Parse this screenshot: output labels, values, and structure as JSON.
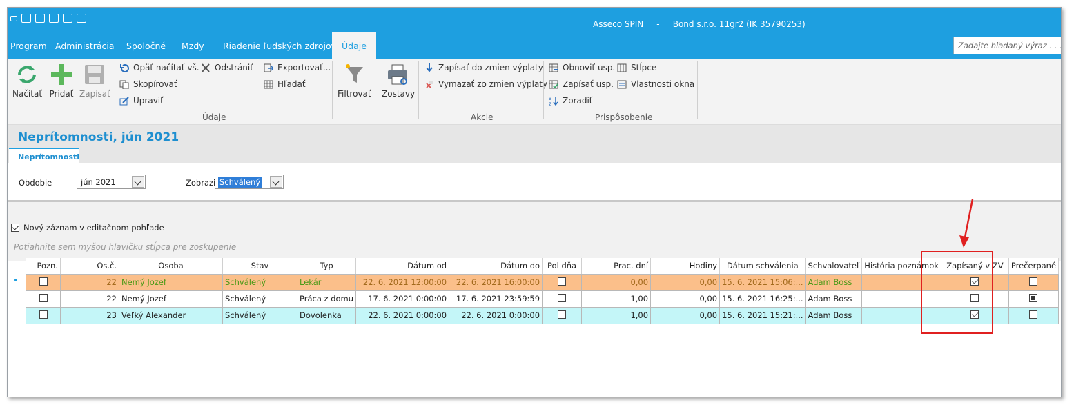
{
  "app": {
    "title": "Asseco SPIN",
    "separator": "-",
    "company": "Bond s.r.o. 11gr2 (IK 35790253)"
  },
  "menu": {
    "items": [
      "Program",
      "Administrácia",
      "Spoločné",
      "Mzdy",
      "Riadenie ľudských zdrojov",
      "Údaje"
    ],
    "active": "Údaje"
  },
  "search": {
    "placeholder": "Zadajte hľadaný výraz . . ."
  },
  "ribbon": {
    "big_buttons": {
      "load": "Načítať",
      "add": "Pridať",
      "save": "Zapísať",
      "filter": "Filtrovať",
      "reports": "Zostavy"
    },
    "data_group": {
      "reload": "Opäť načítať vš.",
      "remove": "Odstrániť",
      "copy": "Skopírovať",
      "edit": "Upraviť",
      "export": "Exportovať...",
      "find": "Hľadať",
      "label": "Údaje"
    },
    "actions_group": {
      "write": "Zapísať do zmien výplaty",
      "erase": "Vymazať zo zmien výplaty",
      "label": "Akcie"
    },
    "custom_group": {
      "refresh": "Obnoviť usp.",
      "columns": "Stĺpce",
      "write": "Zapísať usp.",
      "props": "Vlastnosti okna",
      "sort": "Zoradiť",
      "label": "Prispôsobenie"
    }
  },
  "page": {
    "title": "Neprítomnosti, jún 2021",
    "tab": "Neprítomnosti"
  },
  "form": {
    "period_label": "Obdobie",
    "period_value": "jún 2021",
    "show_label": "Zobraziť",
    "show_value": "Schválený"
  },
  "grid": {
    "new_record_label": "Nový záznam v editačnom pohľade",
    "new_record_checked": true,
    "group_hint": "Potiahnite sem myšou hlavičku stĺpca pre zoskupenie",
    "columns": [
      "Pozn.",
      "Os.č.",
      "Osoba",
      "Stav",
      "Typ",
      "Dátum od",
      "Dátum do",
      "Pol dňa",
      "Prac. dní",
      "Hodiny",
      "Dátum schválenia",
      "Schvalovateľ",
      "História poznámok",
      "Zapísaný v ZV",
      "Prečerpané"
    ],
    "rows": [
      {
        "style": "orange",
        "note": false,
        "num": "22",
        "person": "Nemý Jozef",
        "status": "Schválený",
        "type": "Lekár",
        "from": "22. 6. 2021 12:00:00",
        "to": "22. 6. 2021 16:00:00",
        "half": false,
        "days": "0,00",
        "hours": "0,00",
        "approved": "15. 6. 2021 15:06:...",
        "approver": "Adam Boss",
        "history": "",
        "written": true,
        "overdrawn": "off"
      },
      {
        "style": "white",
        "note": false,
        "num": "22",
        "person": "Nemý Jozef",
        "status": "Schválený",
        "type": "Práca z domu",
        "from": "17. 6. 2021 0:00:00",
        "to": "17. 6. 2021 23:59:59",
        "half": false,
        "days": "1,00",
        "hours": "0,00",
        "approved": "15. 6. 2021 16:25:...",
        "approver": "Adam Boss",
        "history": "",
        "written": false,
        "overdrawn": "indeterminate"
      },
      {
        "style": "cyan",
        "note": false,
        "num": "23",
        "person": "Veľký Alexander",
        "status": "Schválený",
        "type": "Dovolenka",
        "from": "22. 6. 2021 0:00:00",
        "to": "22. 6. 2021 0:00:00",
        "half": false,
        "days": "1,00",
        "hours": "0,00",
        "approved": "15. 6. 2021 15:21:...",
        "approver": "Adam Boss",
        "history": "",
        "written": true,
        "overdrawn": "off"
      }
    ]
  },
  "colors": {
    "accent": "#1e9fe0",
    "highlight": "#e02020",
    "row_orange": "#fbbf8a",
    "row_cyan": "#c4f6f8"
  }
}
